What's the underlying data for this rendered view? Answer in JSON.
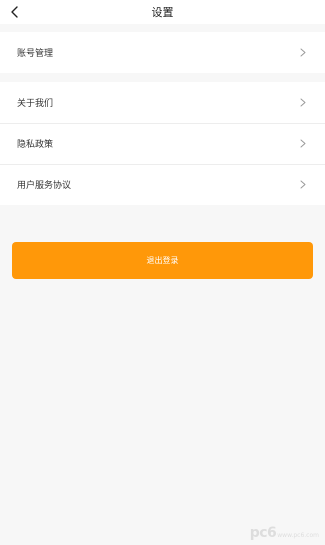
{
  "header": {
    "title": "设置",
    "back_icon": "chevron-left-icon"
  },
  "group1": {
    "items": [
      {
        "label": "账号管理",
        "icon": "chevron-right-icon"
      }
    ]
  },
  "group2": {
    "items": [
      {
        "label": "关于我们",
        "icon": "chevron-right-icon"
      },
      {
        "label": "隐私政策",
        "icon": "chevron-right-icon"
      },
      {
        "label": "用户服务协议",
        "icon": "chevron-right-icon"
      }
    ]
  },
  "logout": {
    "label": "退出登录"
  },
  "watermark": {
    "text": "pc6",
    "sub": "www.pc6.com"
  },
  "colors": {
    "accent": "#ff9809",
    "background": "#f7f7f7",
    "surface": "#ffffff"
  }
}
